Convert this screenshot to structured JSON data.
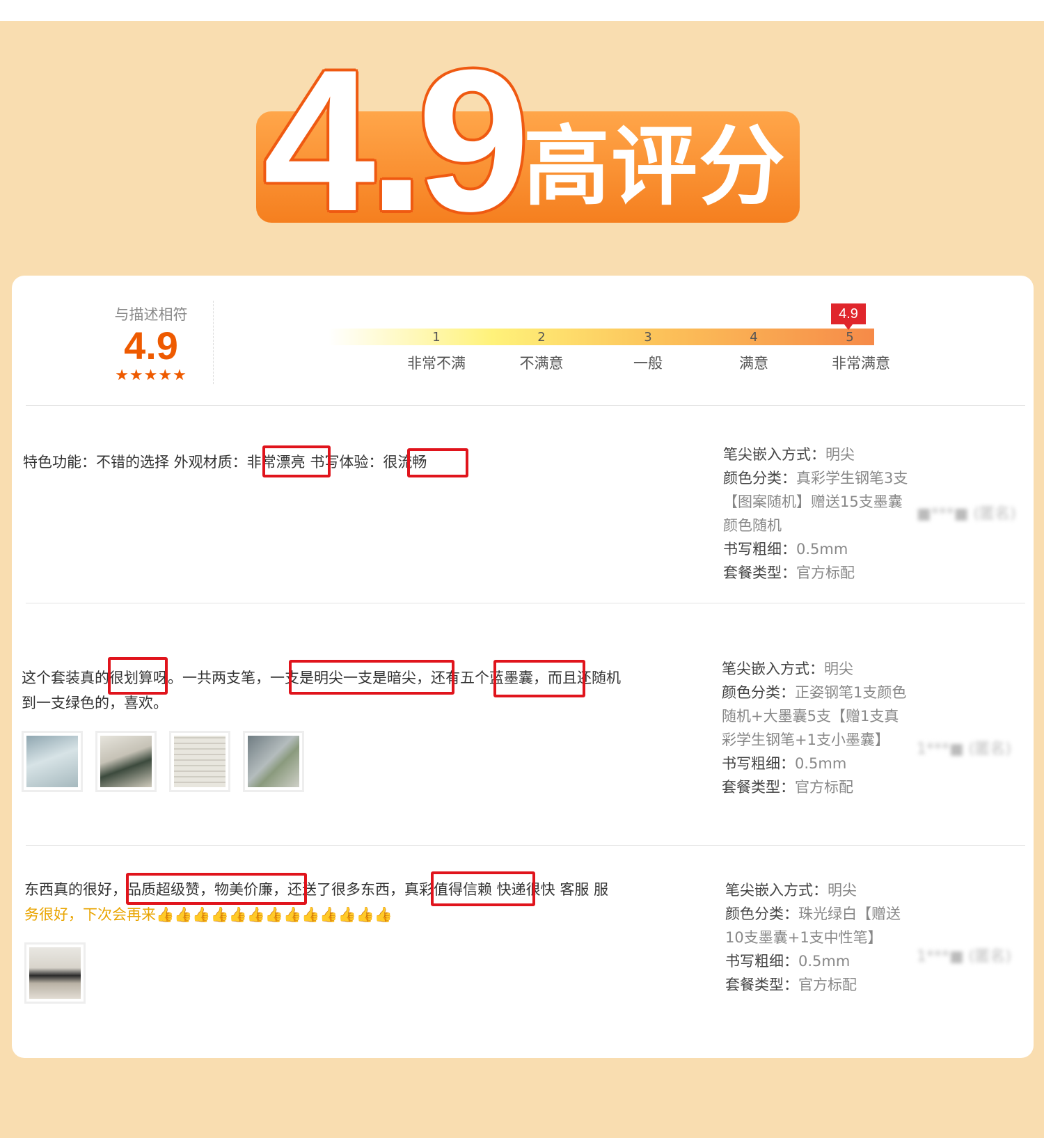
{
  "banner": {
    "score": "4.9",
    "label": "高评分"
  },
  "rating": {
    "title": "与描述相符",
    "score": "4.9",
    "stars": "★★★★★",
    "flag": "4.9",
    "ticks": [
      "1",
      "2",
      "3",
      "4",
      "5"
    ],
    "labels": [
      "非常不满",
      "不满意",
      "一般",
      "满意",
      "非常满意"
    ],
    "value": 4.9,
    "max": 5
  },
  "reviews": [
    {
      "lines": [
        "特色功能：不错的选择 外观材质：非常漂亮 书写体验：很流畅"
      ],
      "highlights": [
        "非常漂亮",
        "很流畅"
      ],
      "specs": [
        {
          "k": "笔尖嵌入方式：",
          "v": "明尖"
        },
        {
          "k": "颜色分类：",
          "v": "真彩学生钢笔3支【图案随机】赠送15支墨囊颜色随机"
        },
        {
          "k": "书写粗细：",
          "v": "0.5mm"
        },
        {
          "k": "套餐类型：",
          "v": "官方标配"
        }
      ],
      "user": "■***■ (匿名)"
    },
    {
      "lines": [
        "这个套装真的很划算呀。一共两支笔，一支是明尖一支是暗尖，还有五个蓝墨囊，而且还随机",
        "到一支绿色的，喜欢。"
      ],
      "highlights": [
        "很划算",
        "一支是明尖一支是暗尖，",
        "五个蓝墨囊，"
      ],
      "specs": [
        {
          "k": "笔尖嵌入方式：",
          "v": "明尖"
        },
        {
          "k": "颜色分类：",
          "v": "正姿钢笔1支颜色随机+大墨囊5支【赠1支真彩学生钢笔+1支小墨囊】"
        },
        {
          "k": "书写粗细：",
          "v": "0.5mm"
        },
        {
          "k": "套餐类型：",
          "v": "官方标配"
        }
      ],
      "user": "1***■ (匿名)"
    },
    {
      "lines": [
        "东西真的很好，品质超级赞，物美价廉，还送了很多东西，真彩值得信赖 快递很快 客服 服",
        "务很好，下次会再来👍👍👍👍👍👍👍👍👍👍👍👍👍"
      ],
      "highlights": [
        "品质超级赞，物美价廉",
        "真彩值得信赖"
      ],
      "specs": [
        {
          "k": "笔尖嵌入方式：",
          "v": "明尖"
        },
        {
          "k": "颜色分类：",
          "v": "珠光绿白【赠送10支墨囊+1支中性笔】"
        },
        {
          "k": "书写粗细：",
          "v": "0.5mm"
        },
        {
          "k": "套餐类型：",
          "v": "官方标配"
        }
      ],
      "user": "1***■ (匿名)"
    }
  ],
  "colors": {
    "page_bg": "#f9ddb0",
    "banner_orange": "#f57f1f",
    "score_orange": "#ee5a00",
    "highlight_red": "#e0141c"
  }
}
